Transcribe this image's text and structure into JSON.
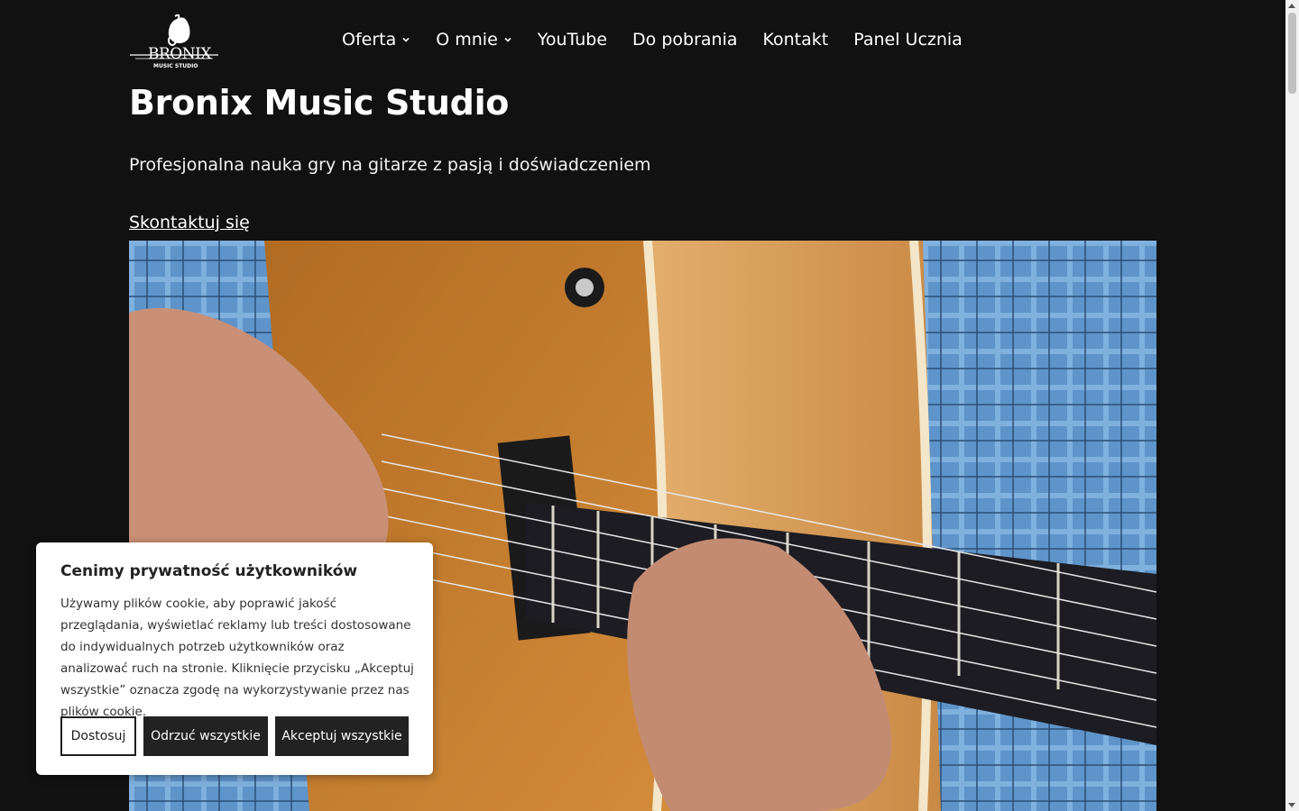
{
  "brand": {
    "logo_text": "BRONIX",
    "logo_subtext": "MUSIC STUDIO"
  },
  "nav": {
    "items": [
      {
        "label": "Oferta",
        "has_dropdown": true
      },
      {
        "label": "O mnie",
        "has_dropdown": true
      },
      {
        "label": "YouTube",
        "has_dropdown": false
      },
      {
        "label": "Do pobrania",
        "has_dropdown": false
      },
      {
        "label": "Kontakt",
        "has_dropdown": false
      },
      {
        "label": "Panel Ucznia",
        "has_dropdown": false
      }
    ]
  },
  "hero": {
    "title": "Bronix Music Studio",
    "subtitle": "Profesjonalna nauka gry na gitarze z pasją i doświadczeniem",
    "cta_label": "Skontaktuj się",
    "image_subject": "guitar-player-photo"
  },
  "cookie": {
    "title": "Cenimy prywatność użytkowników",
    "text": "Używamy plików cookie, aby poprawić jakość przeglądania, wyświetlać reklamy lub treści dostosowane do indywidualnych potrzeb użytkowników oraz analizować ruch na stronie. Kliknięcie przycisku „Akceptuj wszystkie” oznacza zgodę na wykorzystywanie przez nas plików cookie.",
    "customize_label": "Dostosuj",
    "reject_label": "Odrzuć wszystkie",
    "accept_label": "Akceptuj wszystkie"
  },
  "colors": {
    "background": "#111112",
    "text": "#ffffff",
    "button_dark": "#222222"
  }
}
